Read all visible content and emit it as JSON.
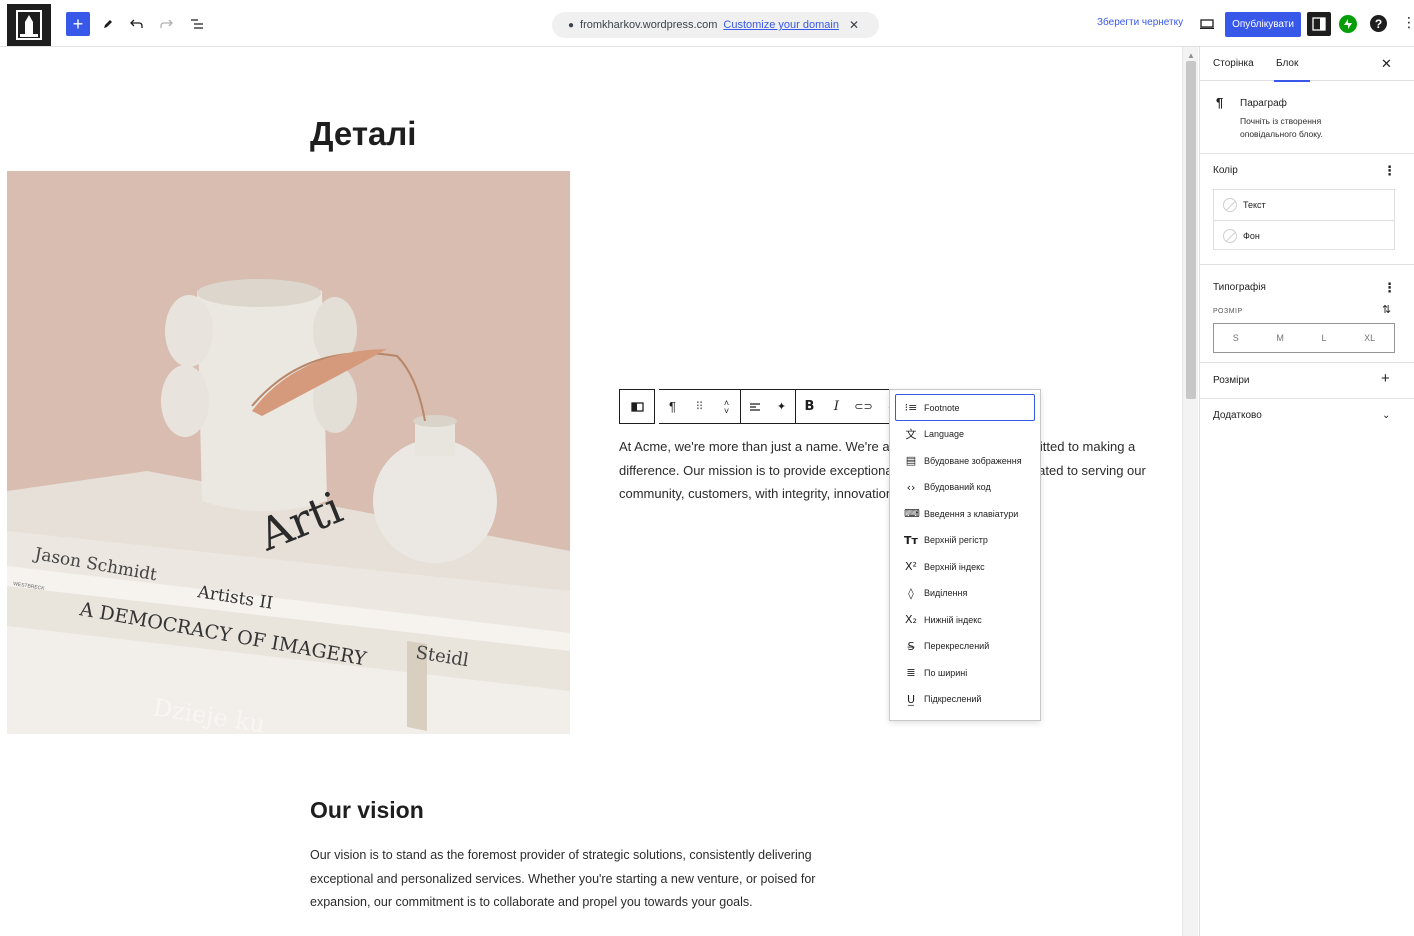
{
  "topbar": {
    "url_domain": "fromkharkov.wordpress.com",
    "customize_link": "Customize your domain",
    "save_draft": "Зберегти чернетку",
    "publish": "Опублікувати"
  },
  "canvas": {
    "heading": "Деталі",
    "body_text": "At Acme, we're more than just a name. We're a team of individuals committed to making a difference. Our mission is to provide exceptional service, and we're dedicated to serving our community, customers, with integrity, innovation, and a personal touch.",
    "vision_heading": "Our vision",
    "vision_text": "Our vision is to stand as the foremost provider of strategic solutions, consistently delivering exceptional and personalized services. Whether you're starting a new venture, or poised for expansion, our commitment is to collaborate and propel you towards your goals.",
    "image": {
      "book_author": "Jason Schmidt",
      "book_title_1": "Artists II",
      "book_title_2": "A DEMOCRACY OF IMAGERY",
      "book_publisher": "Steidl",
      "book_spine_small": "WESTBRECK",
      "book_cover_word": "Arti",
      "book_bottom_word": "Dzieje ku"
    }
  },
  "format_menu": {
    "items": [
      {
        "icon": "list-icon",
        "glyph": "⁝≡",
        "label": "Footnote"
      },
      {
        "icon": "language-icon",
        "glyph": "文",
        "label": "Language"
      },
      {
        "icon": "inline-image-icon",
        "glyph": "▤",
        "label": "Вбудоване зображення"
      },
      {
        "icon": "code-icon",
        "glyph": "‹›",
        "label": "Вбудований код"
      },
      {
        "icon": "keyboard-icon",
        "glyph": "⌨",
        "label": "Введення з клавіатури"
      },
      {
        "icon": "uppercase-icon",
        "glyph": "Tт",
        "label": "Верхній регістр"
      },
      {
        "icon": "superscript-icon",
        "glyph": "X²",
        "label": "Верхній індекс"
      },
      {
        "icon": "highlight-icon",
        "glyph": "◊",
        "label": "Виділення"
      },
      {
        "icon": "subscript-icon",
        "glyph": "X₂",
        "label": "Нижній індекс"
      },
      {
        "icon": "strikethrough-icon",
        "glyph": "S̶",
        "label": "Перекреслений"
      },
      {
        "icon": "justify-icon",
        "glyph": "≣",
        "label": "По ширині"
      },
      {
        "icon": "underline-icon",
        "glyph": "U̲",
        "label": "Підкреслений"
      }
    ]
  },
  "sidebar": {
    "tab_page": "Сторінка",
    "tab_block": "Блок",
    "block_title": "Параграф",
    "block_desc": "Почніть із створення оповідального блоку.",
    "color_panel": "Колір",
    "color_text": "Текст",
    "color_bg": "Фон",
    "typography_panel": "Типографія",
    "size_label": "РОЗМІР",
    "sizes": [
      "S",
      "M",
      "L",
      "XL"
    ],
    "dimensions_panel": "Розміри",
    "advanced_panel": "Додатково"
  },
  "colors": {
    "accent": "#3858e9",
    "dark": "#1e1e1e",
    "jetpack": "#069e08"
  }
}
